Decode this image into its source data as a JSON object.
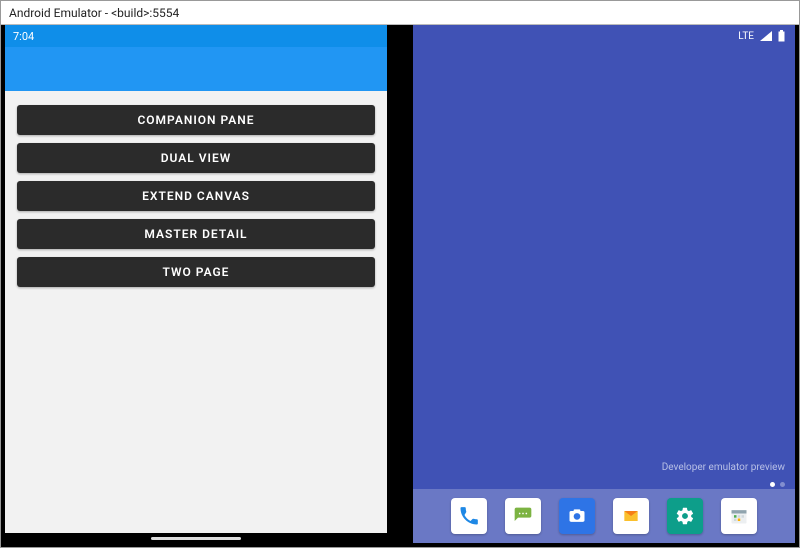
{
  "window": {
    "title": "Android Emulator - <build>:5554"
  },
  "left": {
    "clock": "7:04",
    "buttons": [
      "COMPANION PANE",
      "DUAL VIEW",
      "EXTEND CANVAS",
      "MASTER DETAIL",
      "TWO PAGE"
    ]
  },
  "right": {
    "status": {
      "network": "LTE"
    },
    "preview_text": "Developer emulator preview",
    "dock": [
      "phone",
      "messages",
      "camera",
      "mail",
      "settings",
      "calendar"
    ]
  }
}
